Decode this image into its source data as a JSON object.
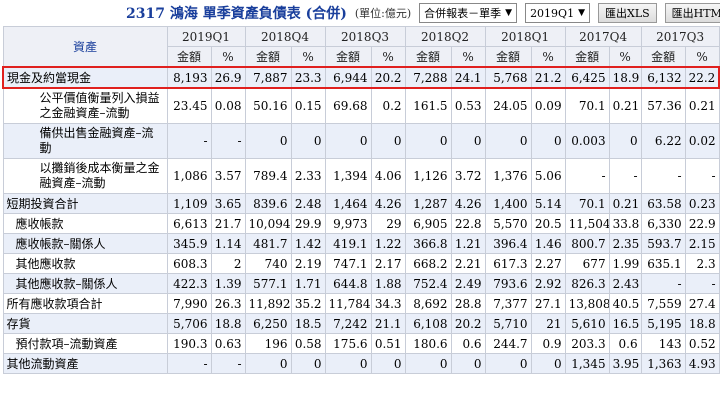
{
  "header": {
    "title": "2317 鴻海 單季資產負債表 (合併)",
    "unit": "(單位:億元)",
    "report_select": "合併報表－單季",
    "period_select": "2019Q1",
    "export_xls": "匯出XLS",
    "export_html": "匯出HTML"
  },
  "table": {
    "asset_header": "資產",
    "periods": [
      "2019Q1",
      "2018Q4",
      "2018Q3",
      "2018Q2",
      "2018Q1",
      "2017Q4",
      "2017Q3"
    ],
    "amount_label": "金額",
    "pct_label": "%",
    "rows": [
      {
        "label": "現金及約當現金",
        "values": [
          "8,193",
          "26.9",
          "7,887",
          "23.3",
          "6,944",
          "20.2",
          "7,288",
          "24.1",
          "5,768",
          "21.2",
          "6,425",
          "18.9",
          "6,132",
          "22.2"
        ]
      },
      {
        "label": "公平價值衡量列入損益之金融資產–流動",
        "values": [
          "23.45",
          "0.08",
          "50.16",
          "0.15",
          "69.68",
          "0.2",
          "161.5",
          "0.53",
          "24.05",
          "0.09",
          "70.1",
          "0.21",
          "57.36",
          "0.21"
        ]
      },
      {
        "label": "備供出售金融資產–流動",
        "values": [
          "-",
          "-",
          "0",
          "0",
          "0",
          "0",
          "0",
          "0",
          "0",
          "0",
          "0.003",
          "0",
          "6.22",
          "0.02"
        ]
      },
      {
        "label": "以攤銷後成本衡量之金融資產–流動",
        "values": [
          "1,086",
          "3.57",
          "789.4",
          "2.33",
          "1,394",
          "4.06",
          "1,126",
          "3.72",
          "1,376",
          "5.06",
          "-",
          "-",
          "-",
          "-"
        ]
      },
      {
        "label": "短期投資合計",
        "values": [
          "1,109",
          "3.65",
          "839.6",
          "2.48",
          "1,464",
          "4.26",
          "1,287",
          "4.26",
          "1,400",
          "5.14",
          "70.1",
          "0.21",
          "63.58",
          "0.23"
        ]
      },
      {
        "label": "應收帳款",
        "values": [
          "6,613",
          "21.7",
          "10,094",
          "29.9",
          "9,973",
          "29",
          "6,905",
          "22.8",
          "5,570",
          "20.5",
          "11,504",
          "33.8",
          "6,330",
          "22.9"
        ]
      },
      {
        "label": "應收帳款–關係人",
        "values": [
          "345.9",
          "1.14",
          "481.7",
          "1.42",
          "419.1",
          "1.22",
          "366.8",
          "1.21",
          "396.4",
          "1.46",
          "800.7",
          "2.35",
          "593.7",
          "2.15"
        ]
      },
      {
        "label": "其他應收款",
        "values": [
          "608.3",
          "2",
          "740",
          "2.19",
          "747.1",
          "2.17",
          "668.2",
          "2.21",
          "617.3",
          "2.27",
          "677",
          "1.99",
          "635.1",
          "2.3"
        ]
      },
      {
        "label": "其他應收款–關係人",
        "values": [
          "422.3",
          "1.39",
          "577.1",
          "1.71",
          "644.8",
          "1.88",
          "752.4",
          "2.49",
          "793.6",
          "2.92",
          "826.3",
          "2.43",
          "-",
          "-"
        ]
      },
      {
        "label": "所有應收款項合計",
        "values": [
          "7,990",
          "26.3",
          "11,892",
          "35.2",
          "11,784",
          "34.3",
          "8,692",
          "28.8",
          "7,377",
          "27.1",
          "13,808",
          "40.5",
          "7,559",
          "27.4"
        ]
      },
      {
        "label": "存貨",
        "values": [
          "5,706",
          "18.8",
          "6,250",
          "18.5",
          "7,242",
          "21.1",
          "6,108",
          "20.2",
          "5,710",
          "21",
          "5,610",
          "16.5",
          "5,195",
          "18.8"
        ]
      },
      {
        "label": "預付款項–流動資產",
        "values": [
          "190.3",
          "0.63",
          "196",
          "0.58",
          "175.6",
          "0.51",
          "180.6",
          "0.6",
          "244.7",
          "0.9",
          "203.3",
          "0.6",
          "143",
          "0.52"
        ]
      },
      {
        "label": "其他流動資產",
        "values": [
          "-",
          "-",
          "0",
          "0",
          "0",
          "0",
          "0",
          "0",
          "0",
          "0",
          "1,345",
          "3.95",
          "1,363",
          "4.93"
        ]
      }
    ]
  },
  "colors": {
    "title": "#1a3f9c",
    "header_bg": "#eef0f6",
    "row_alt_bg": "#eaeff9",
    "border": "#c8cdd8",
    "highlight": "#e0201e"
  }
}
